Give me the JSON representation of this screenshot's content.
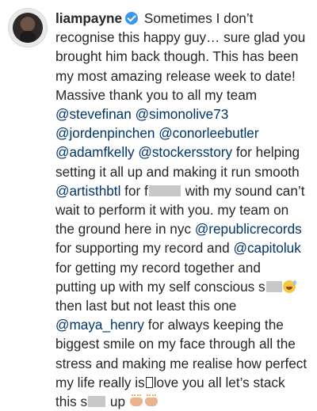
{
  "post": {
    "username": "liampayne",
    "verified": true,
    "lines": [
      {
        "after_user": " Sometimes I don’t"
      },
      {
        "text": "recognise this happy guy… sure glad you"
      },
      {
        "text": "brought him back though. This has been"
      },
      {
        "text": "my most amazing release week to date!"
      },
      {
        "text": "Massive thank you to all my team"
      },
      {
        "mentions": [
          "@stevefinan",
          "@simonolive73"
        ]
      },
      {
        "mentions": [
          "@jordenpinchen",
          "@conorleebutler"
        ]
      },
      {
        "mention_a": "@adamfkelly",
        "mention_b": "@stockersstory",
        "tail": " for helping"
      },
      {
        "text": "setting it all up and making it run smooth"
      },
      {
        "mention": "@artisthbtl",
        "pre_censor": " for f",
        "post_censor": " with my sound can’t"
      },
      {
        "text": "wait to perform it with you. my team on"
      },
      {
        "text_pre": "the ground here in nyc ",
        "mention": "@republicrecords"
      },
      {
        "text_pre": "for supporting my record and ",
        "mention": "@capitoluk"
      },
      {
        "text": "for getting my record together and"
      },
      {
        "text_pre": "putting up with my self conscious s"
      },
      {
        "text": "then last but not least this one"
      },
      {
        "mention": "@maya_henry",
        "tail": " for always keeping the"
      },
      {
        "text": "biggest smile on my face through all the"
      },
      {
        "text": "stress and making me realise how perfect"
      },
      {
        "text_pre": "my life really is",
        "text_post": "love you all let’s stack"
      },
      {
        "text_pre": "this s",
        "text_post": " up"
      }
    ],
    "icons": {
      "verified": "verified-badge-icon",
      "sweat_smile": "sweat-smile-emoji",
      "raised_hands": "raised-hands-emoji",
      "missing_glyph": "missing-glyph-box"
    },
    "colors": {
      "text": "#262626",
      "mention": "#003569",
      "verified": "#3897f0",
      "censor": "#c7c7c7"
    }
  }
}
